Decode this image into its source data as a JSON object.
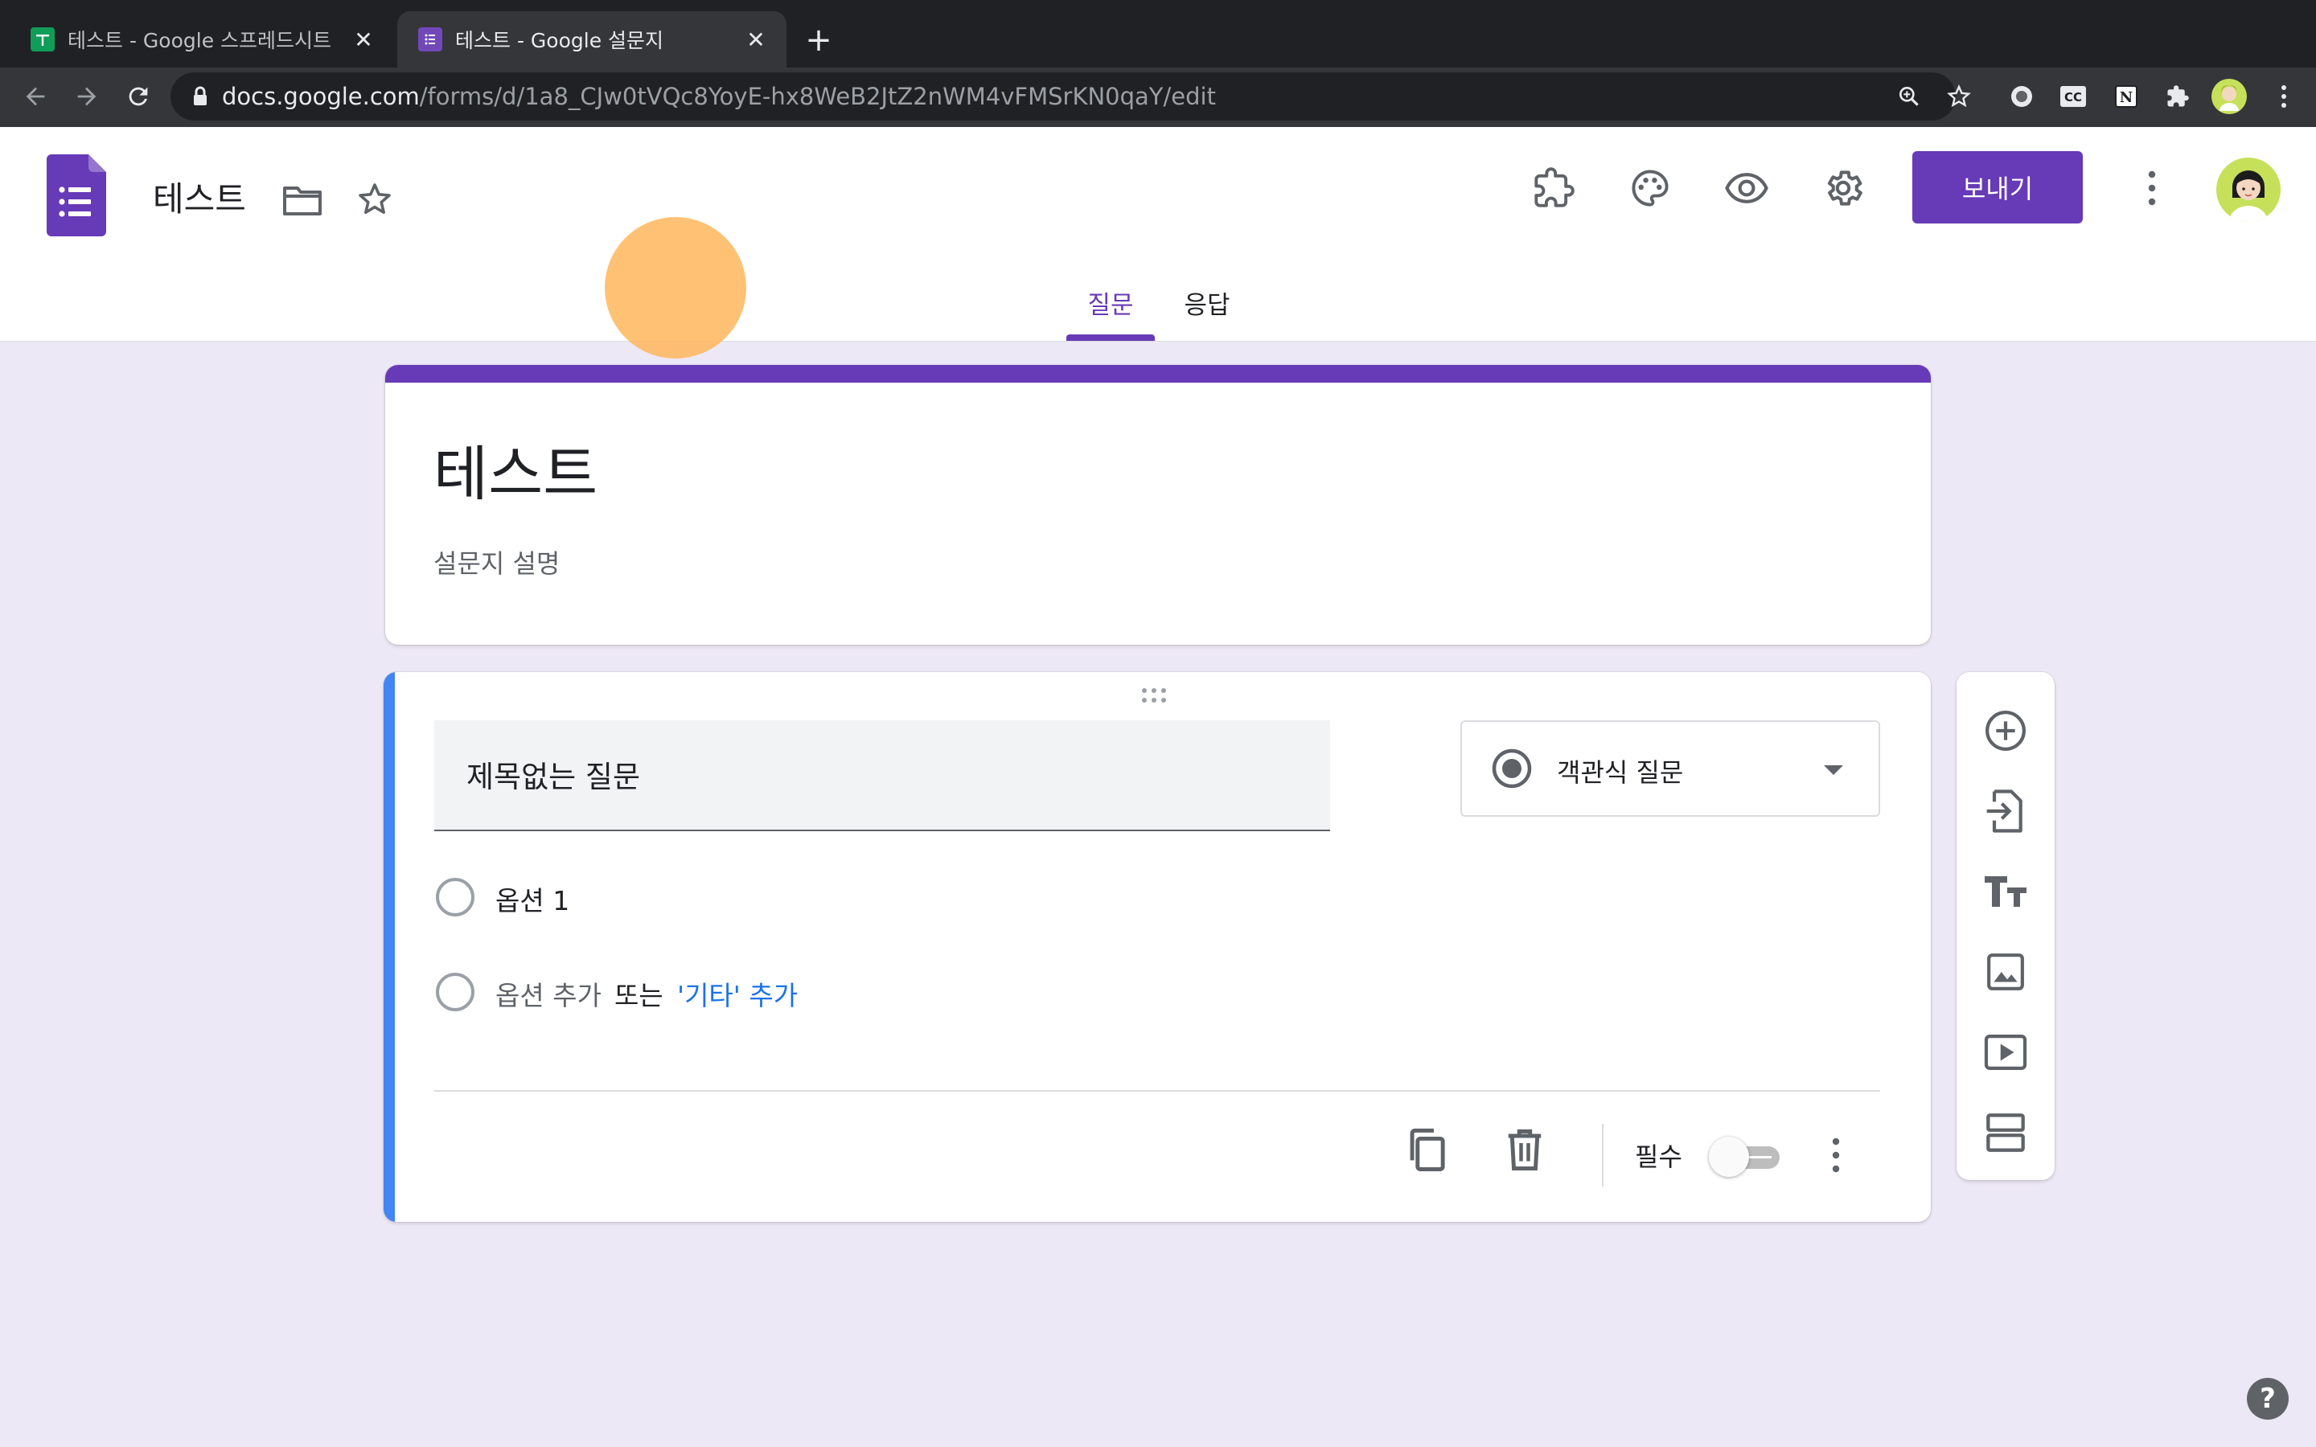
{
  "browser": {
    "tabs": [
      {
        "title": "테스트 - Google 스프레드시트",
        "favicon": "sheets-icon",
        "active": false
      },
      {
        "title": "테스트 - Google 설문지",
        "favicon": "forms-icon",
        "active": true
      }
    ],
    "new_tab_label": "+",
    "url_host": "docs.google.com",
    "url_path": "/forms/d/1a8_CJw0tVQc8YoyE-hx8WeB2JtZ2nWM4vFMSrKN0qaY/edit"
  },
  "header": {
    "doc_title": "테스트",
    "send_label": "보내기",
    "tabs": [
      {
        "label": "질문",
        "active": true
      },
      {
        "label": "응답",
        "active": false
      }
    ]
  },
  "form": {
    "title": "테스트",
    "description": "설문지 설명",
    "accent_color": "#673ab7"
  },
  "question": {
    "title": "제목없는 질문",
    "type_label": "객관식 질문",
    "option1": "옵션 1",
    "add_option": "옵션 추가",
    "or_text": "또는",
    "add_other": "'기타' 추가",
    "required_label": "필수",
    "required": false
  },
  "colors": {
    "purple": "#673ab7",
    "blue_link": "#1a73e8",
    "focus_bar": "#4285f4",
    "cursor_highlight": "#ffb65c"
  },
  "help_label": "?"
}
